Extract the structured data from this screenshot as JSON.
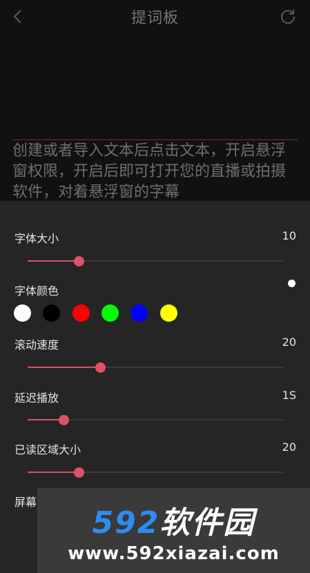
{
  "header": {
    "title": "提词板",
    "back_icon": "chevron-left-icon",
    "refresh_icon": "refresh-icon"
  },
  "editor": {
    "placeholder_text": "创建或者导入文本后点击文本，开启悬浮窗权限，开启后即可打开您的直播或拍摄软件，对着悬浮窗的字幕"
  },
  "settings": {
    "font_size": {
      "label": "字体大小",
      "value": "10",
      "level": 0.2
    },
    "font_color": {
      "label": "字体颜色",
      "options": [
        "#ffffff",
        "#000000",
        "#ff0000",
        "#00ff00",
        "#0000ff",
        "#ffff00"
      ],
      "selected": "#ffffff"
    },
    "scroll_speed": {
      "label": "滚动速度",
      "value": "20",
      "level": 0.285
    },
    "delay_play": {
      "label": "延迟播放",
      "value": "1S",
      "level": 0.14
    },
    "read_area_size": {
      "label": "已读区域大小",
      "value": "20",
      "level": 0.2
    },
    "screen": {
      "label": "屏幕"
    }
  },
  "accent_color": "#e05068",
  "watermark": {
    "logo_number": "592",
    "logo_text": "软件园",
    "url": "www.592xiazai.com"
  }
}
